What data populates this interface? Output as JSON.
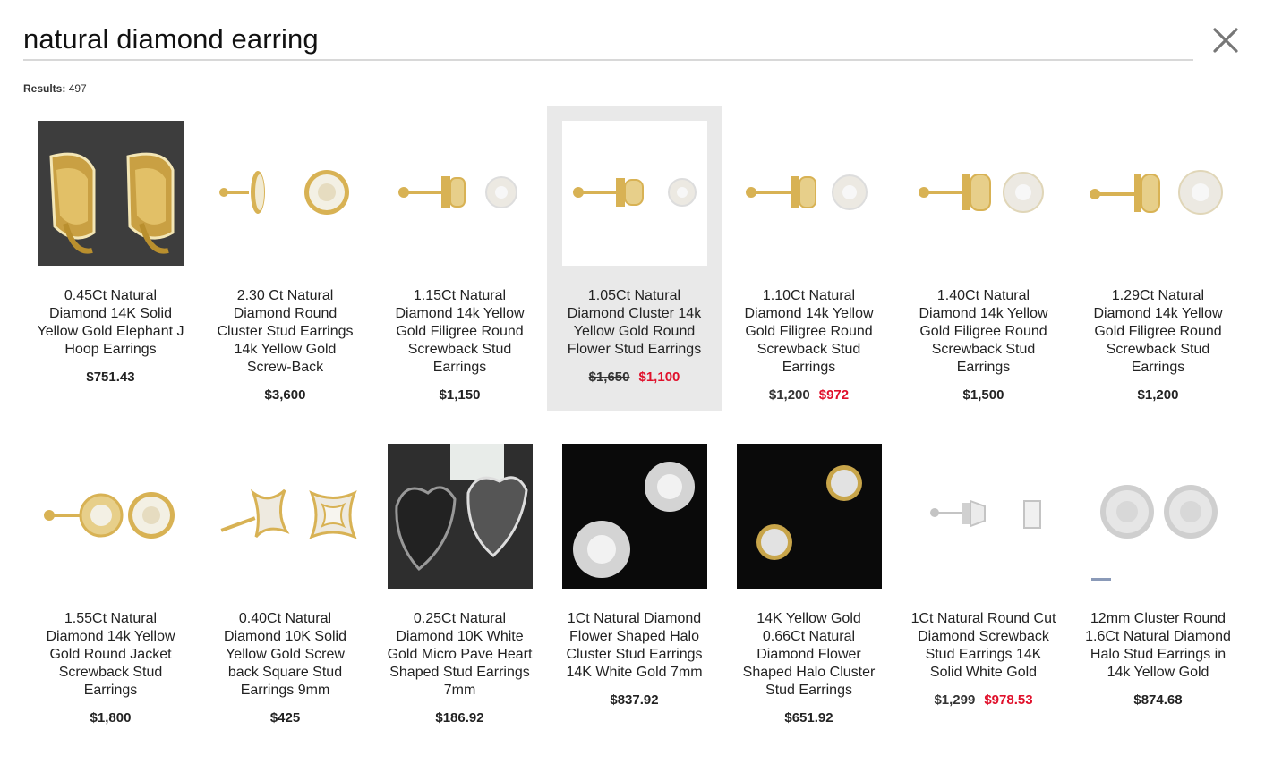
{
  "search": {
    "query": "natural diamond earring"
  },
  "results": {
    "label": "Results:",
    "count": "497"
  },
  "colors": {
    "sale": "#e0102b",
    "active_bg": "#e9e9e9",
    "gold": "#d8b254"
  },
  "icons": {
    "close": "close-icon"
  },
  "products": [
    {
      "title": "0.45Ct Natural Diamond 14K Solid Yellow Gold Elephant J Hoop Earrings",
      "price": "$751.43",
      "old_price": "",
      "sale_price": ""
    },
    {
      "title": "2.30 Ct Natural Diamond Round Cluster Stud Earrings 14k Yellow Gold Screw-Back",
      "price": "$3,600",
      "old_price": "",
      "sale_price": ""
    },
    {
      "title": "1.15Ct Natural Diamond 14k Yellow Gold Filigree Round Screwback Stud Earrings",
      "price": "$1,150",
      "old_price": "",
      "sale_price": ""
    },
    {
      "title": "1.05Ct Natural Diamond Cluster 14k Yellow Gold Round Flower Stud Earrings",
      "price": "",
      "old_price": "$1,650",
      "sale_price": "$1,100"
    },
    {
      "title": "1.10Ct Natural Diamond 14k Yellow Gold Filigree Round Screwback Stud Earrings",
      "price": "",
      "old_price": "$1,200",
      "sale_price": "$972"
    },
    {
      "title": "1.40Ct Natural Diamond 14k Yellow Gold Filigree Round Screwback Stud Earrings",
      "price": "$1,500",
      "old_price": "",
      "sale_price": ""
    },
    {
      "title": "1.29Ct Natural Diamond 14k Yellow Gold Filigree Round Screwback Stud Earrings",
      "price": "$1,200",
      "old_price": "",
      "sale_price": ""
    },
    {
      "title": "1.55Ct Natural Diamond 14k Yellow Gold Round Jacket Screwback Stud Earrings",
      "price": "$1,800",
      "old_price": "",
      "sale_price": ""
    },
    {
      "title": "0.40Ct Natural Diamond 10K Solid Yellow Gold Screw back Square Stud Earrings 9mm",
      "price": "$425",
      "old_price": "",
      "sale_price": ""
    },
    {
      "title": "0.25Ct Natural Diamond 10K White Gold Micro Pave Heart Shaped Stud Earrings 7mm",
      "price": "$186.92",
      "old_price": "",
      "sale_price": ""
    },
    {
      "title": "1Ct Natural Diamond Flower Shaped Halo Cluster Stud Earrings 14K White Gold 7mm",
      "price": "$837.92",
      "old_price": "",
      "sale_price": ""
    },
    {
      "title": "14K Yellow Gold 0.66Ct Natural Diamond Flower Shaped Halo Cluster Stud Earrings",
      "price": "$651.92",
      "old_price": "",
      "sale_price": ""
    },
    {
      "title": "1Ct Natural Round Cut Diamond Screwback Stud Earrings 14K Solid White Gold",
      "price": "",
      "old_price": "$1,299",
      "sale_price": "$978.53"
    },
    {
      "title": "12mm Cluster Round 1.6Ct Natural Diamond Halo Stud Earrings in 14k Yellow Gold",
      "price": "$874.68",
      "old_price": "",
      "sale_price": ""
    }
  ]
}
